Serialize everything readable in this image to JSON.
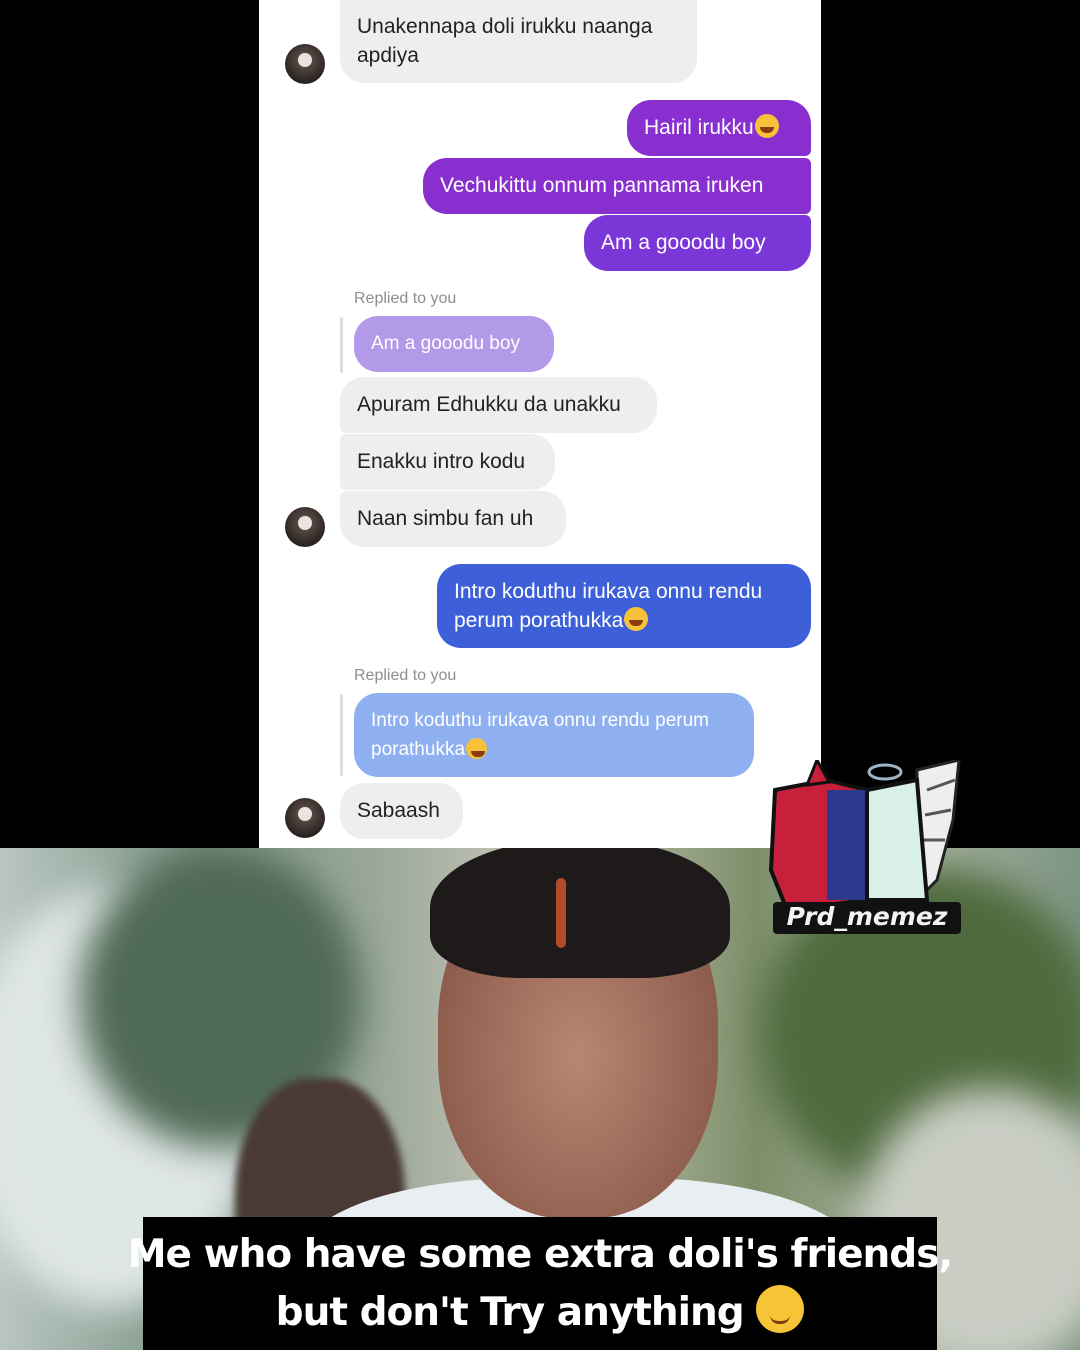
{
  "chat": {
    "messages": [
      {
        "side": "in",
        "text": "Unakennapa doli irukku naanga apdiya"
      },
      {
        "side": "out",
        "text": "Hairil irukku"
      },
      {
        "side": "out",
        "text": "Vechukittu onnum pannama iruken"
      },
      {
        "side": "out",
        "text": "Am a gooodu boy"
      },
      {
        "side": "reply_label",
        "text": "Replied to you"
      },
      {
        "side": "quoted",
        "text": "Am a gooodu boy"
      },
      {
        "side": "in",
        "text": "Apuram Edhukku da unakku"
      },
      {
        "side": "in",
        "text": "Enakku intro kodu"
      },
      {
        "side": "in",
        "text": "Naan simbu fan uh"
      },
      {
        "side": "out",
        "text": "Intro koduthu irukava onnu rendu perum porathukka"
      },
      {
        "side": "reply_label",
        "text": "Replied to you"
      },
      {
        "side": "quoted",
        "text": "Intro koduthu irukava onnu rendu perum porathukka"
      },
      {
        "side": "in",
        "text": "Sabaash"
      }
    ],
    "emoji_name": "face-with-tears-of-joy-icon",
    "colors": {
      "incoming": "#eeeeee",
      "outgoing_purple": "#8a2fcf",
      "outgoing_blue": "#3d5fd8",
      "quoted_lilac": "#b39ae8",
      "quoted_sky": "#8fb0f0"
    }
  },
  "watermark": {
    "text": "Prd_memez"
  },
  "caption": {
    "line1": "Me who have some extra doli's friends,",
    "line2": "but don't Try anything",
    "emoji_name": "relieved-face-icon"
  }
}
